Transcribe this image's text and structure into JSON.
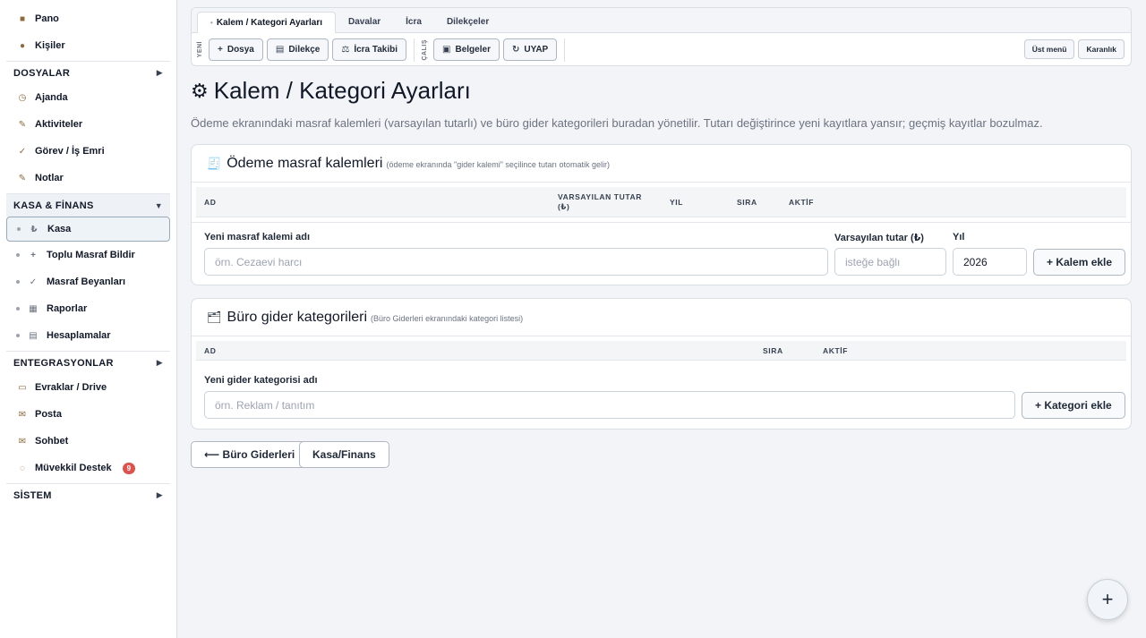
{
  "sidebar": {
    "top_items": [
      {
        "label": "Pano",
        "icon": "dashboard-icon",
        "glyph": "■"
      },
      {
        "label": "Kişiler",
        "icon": "people-icon",
        "glyph": "●"
      }
    ],
    "sections": {
      "dosyalar": {
        "label": "DOSYALAR",
        "arrow": "▶"
      },
      "kasa": {
        "label": "KASA & FİNANS",
        "arrow": "▼"
      },
      "entegrasyonlar": {
        "label": "ENTEGRASYONLAR",
        "arrow": "▶"
      },
      "sistem": {
        "label": "SİSTEM",
        "arrow": "▶"
      }
    },
    "dosya_items": [
      {
        "label": "Ajanda",
        "glyph": "◷"
      },
      {
        "label": "Aktiviteler",
        "glyph": "✎"
      },
      {
        "label": "Görev / İş Emri",
        "glyph": "✓"
      },
      {
        "label": "Notlar",
        "glyph": "✎"
      }
    ],
    "kasa_items": [
      {
        "label": "Kasa",
        "glyph": "₺"
      },
      {
        "label": "Toplu Masraf Bildir",
        "glyph": "+"
      },
      {
        "label": "Masraf Beyanları",
        "glyph": "✓"
      },
      {
        "label": "Raporlar",
        "glyph": "▦"
      },
      {
        "label": "Hesaplamalar",
        "glyph": "▤"
      }
    ],
    "entegrasyon_items": [
      {
        "label": "Evraklar / Drive",
        "glyph": "▭"
      },
      {
        "label": "Posta",
        "glyph": "✉"
      },
      {
        "label": "Sohbet",
        "glyph": "✉"
      },
      {
        "label": "Müvekkil Destek",
        "glyph": "◌",
        "badge": "9"
      }
    ]
  },
  "toolbar": {
    "tabs": [
      "Kalem / Kategori Ayarları",
      "Davalar",
      "İcra",
      "Dilekçeler"
    ],
    "tab_bullet": "•",
    "group1_label": "YENİ",
    "group2_label": "ÇALIŞ",
    "buttons": {
      "dosya": {
        "label": "Dosya",
        "glyph": "+"
      },
      "dilekce": {
        "label": "Dilekçe",
        "glyph": "▤"
      },
      "icra": {
        "label": "İcra Takibi",
        "glyph": "⚖"
      },
      "belgeler": {
        "label": "Belgeler",
        "glyph": "▣"
      },
      "uyap": {
        "label": "UYAP",
        "glyph": "↻"
      }
    },
    "ust_menu": "Üst menü",
    "karanlik": "Karanlık"
  },
  "page": {
    "title_glyph": "⚙",
    "title": "Kalem / Kategori Ayarları",
    "description": "Ödeme ekranındaki masraf kalemleri (varsayılan tutarlı) ve büro gider kategorileri buradan yönetilir. Tutarı değiştirince yeni kayıtlara yansır; geçmiş kayıtlar bozulmaz."
  },
  "masraf_card": {
    "glyph": "🧾",
    "title": "Ödeme masraf kalemleri",
    "hint": "(ödeme ekranında \"gider kalemi\" seçilince tutarı otomatik gelir)",
    "columns": {
      "ad": "AD",
      "tutar": "VARSAYILAN TUTAR (₺)",
      "yil": "YIL",
      "sira": "SIRA",
      "aktif": "AKTİF"
    },
    "name_label": "Yeni masraf kalemi adı",
    "name_placeholder": "örn. Cezaevi harcı",
    "amount_label": "Varsayılan tutar (₺)",
    "amount_placeholder": "isteğe bağlı",
    "year_label": "Yıl",
    "year_value": "2026",
    "add_button": "+ Kalem ekle"
  },
  "gider_card": {
    "glyph": "🗂",
    "title": "Büro gider kategorileri",
    "hint": "(Büro Giderleri ekranındaki kategori listesi)",
    "columns": {
      "ad": "AD",
      "sira": "SIRA",
      "aktif": "AKTİF"
    },
    "name_label": "Yeni gider kategorisi adı",
    "name_placeholder": "örn. Reklam / tanıtım",
    "add_button": "+ Kategori ekle"
  },
  "nav": {
    "back": "⟵ Büro Giderleri",
    "kasa": "Kasa/Finans"
  },
  "fab_glyph": "+"
}
